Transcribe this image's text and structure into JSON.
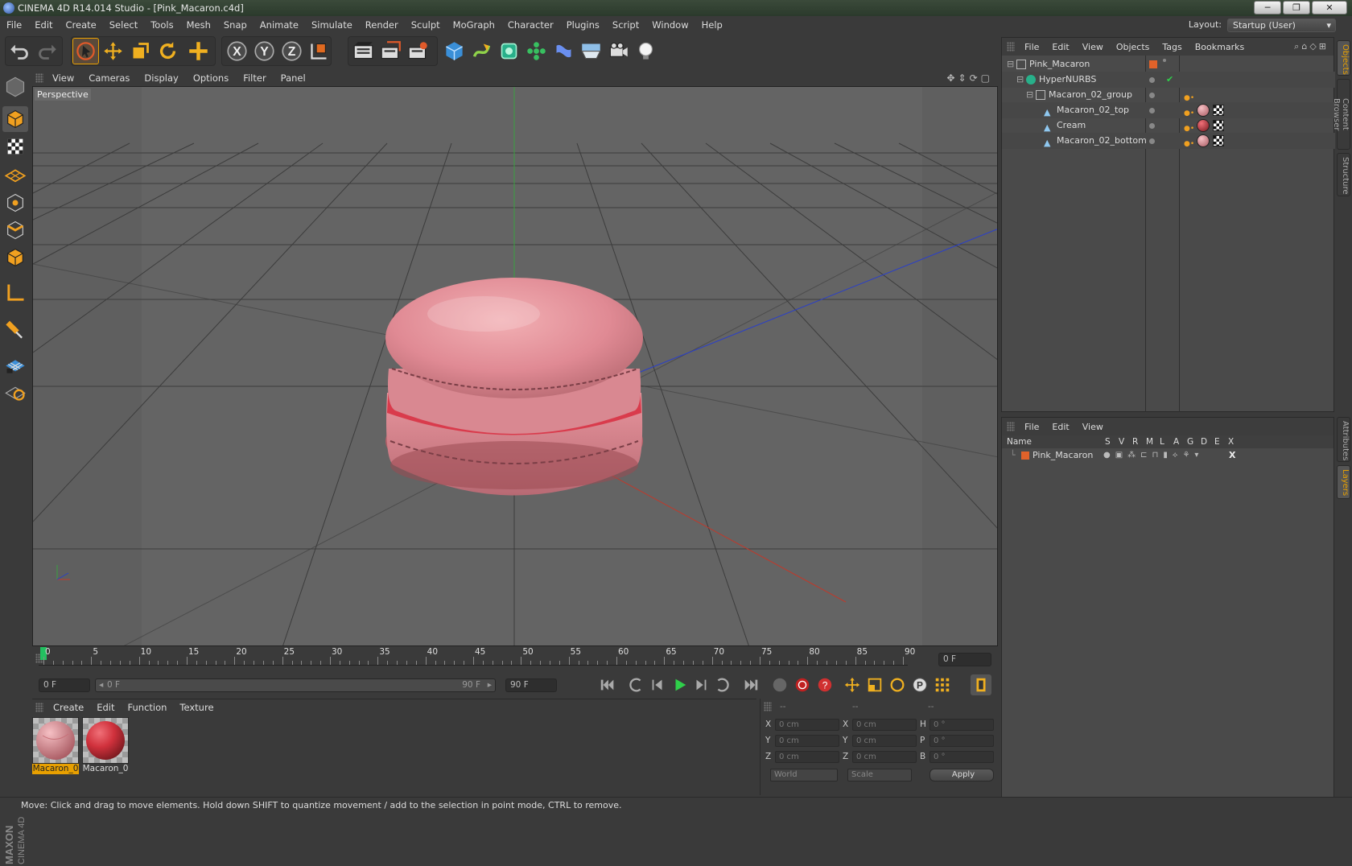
{
  "window": {
    "title": "CINEMA 4D R14.014 Studio - [Pink_Macaron.c4d]",
    "btn_min": "─",
    "btn_max": "❐",
    "btn_close": "✕"
  },
  "menubar": {
    "items": [
      "File",
      "Edit",
      "Create",
      "Select",
      "Tools",
      "Mesh",
      "Snap",
      "Animate",
      "Simulate",
      "Render",
      "Sculpt",
      "MoGraph",
      "Character",
      "Plugins",
      "Script",
      "Window",
      "Help"
    ],
    "layout_label": "Layout:",
    "layout_value": "Startup (User)"
  },
  "toolbar": {
    "icons": [
      "undo-icon",
      "redo-icon",
      "live-selection-icon",
      "move-icon",
      "scale-icon",
      "rotate-icon",
      "add-icon",
      "x-axis-icon",
      "y-axis-icon",
      "z-axis-icon",
      "coordinate-system-icon",
      "render-view-icon",
      "render-picture-viewer-icon",
      "edit-render-settings-icon",
      "cube-icon",
      "spline-pen-icon",
      "subdivision-icon",
      "array-icon",
      "deformer-icon",
      "floor-icon",
      "camera-icon",
      "light-icon"
    ],
    "x_label": "X",
    "y_label": "Y",
    "z_label": "Z"
  },
  "viewport": {
    "menu": [
      "View",
      "Cameras",
      "Display",
      "Options",
      "Filter",
      "Panel"
    ],
    "label": "Perspective"
  },
  "timeline": {
    "ticks": [
      "0",
      "5",
      "10",
      "15",
      "20",
      "25",
      "30",
      "35",
      "40",
      "45",
      "50",
      "55",
      "60",
      "65",
      "70",
      "75",
      "80",
      "85",
      "90"
    ],
    "current_frame": "0 F",
    "start_field": "0 F",
    "range_start": "0 F",
    "range_end": "90 F",
    "end_field": "90 F"
  },
  "materials": {
    "menu": [
      "Create",
      "Edit",
      "Function",
      "Texture"
    ],
    "items": [
      {
        "name": "Macaron_0",
        "selected": true,
        "color": "#e48a94"
      },
      {
        "name": "Macaron_0",
        "selected": false,
        "color": "#d0313c"
      }
    ]
  },
  "coordinates": {
    "header": [
      "--",
      "--",
      "--"
    ],
    "rows": [
      {
        "a": "X",
        "av": "0 cm",
        "b": "X",
        "bv": "0 cm",
        "c": "H",
        "cv": "0 °"
      },
      {
        "a": "Y",
        "av": "0 cm",
        "b": "Y",
        "bv": "0 cm",
        "c": "P",
        "cv": "0 °"
      },
      {
        "a": "Z",
        "av": "0 cm",
        "b": "Z",
        "bv": "0 cm",
        "c": "B",
        "cv": "0 °"
      }
    ],
    "mode1": "World",
    "mode2": "Scale",
    "apply": "Apply"
  },
  "objects": {
    "menu": [
      "File",
      "Edit",
      "View",
      "Objects",
      "Tags",
      "Bookmarks"
    ],
    "tree": [
      {
        "name": "Pink_Macaron",
        "icon": "null-icon"
      },
      {
        "name": "HyperNURBS",
        "icon": "hypernurbs-icon"
      },
      {
        "name": "Macaron_02_group",
        "icon": "null-icon"
      },
      {
        "name": "Macaron_02_top",
        "icon": "polygon-icon"
      },
      {
        "name": "Cream",
        "icon": "polygon-icon"
      },
      {
        "name": "Macaron_02_bottom",
        "icon": "polygon-icon"
      }
    ]
  },
  "layers": {
    "menu": [
      "File",
      "Edit",
      "View"
    ],
    "columns": [
      "Name",
      "S",
      "V",
      "R",
      "M",
      "L",
      "A",
      "G",
      "D",
      "E",
      "X"
    ],
    "rows": [
      {
        "name": "Pink_Macaron",
        "color": "#e0622a"
      }
    ]
  },
  "sidetabs": [
    "Objects",
    "Content Browser",
    "Structure",
    "Attributes",
    "Layers"
  ],
  "brand": "MAXON CINEMA 4D",
  "status": "Move: Click and drag to move elements. Hold down SHIFT to quantize movement / add to the selection in point mode, CTRL to remove.",
  "colors": {
    "accent": "#e8a000",
    "selection": "#e8a000",
    "x_axis": "#c0392b",
    "y_axis": "#27ae60",
    "z_axis": "#2a3fc9"
  }
}
